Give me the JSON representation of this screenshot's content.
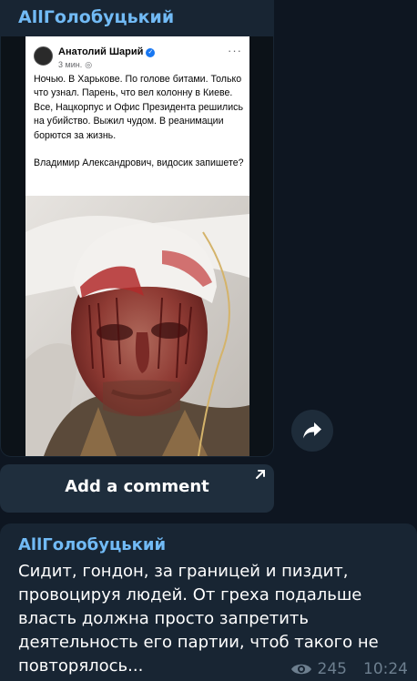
{
  "post": {
    "channel_name": "AllГолобуцький",
    "screenshot": {
      "author": "Анатолий Шарий",
      "time": "3 мин.",
      "more": "···",
      "text": "Ночью. В Харькове. По голове битами. Только что узнал. Парень, что вел колонну в Киеве. Все, Нацкорпус и Офис Президента решились на убийство. Выжил чудом. В реанимации борются за жизнь.\n\nВладимир Александрович, видосик запишете?"
    }
  },
  "comment_button": {
    "label": "Add a comment"
  },
  "reply": {
    "channel_name": "AllГолобуцький",
    "text": "Сидит, гондон, за границей и пиздит, провоцируя людей. От греха подальше власть должна просто запретить деятельность его партии, чтоб такого не повторялось...",
    "views": "245",
    "time": "10:24"
  },
  "icons": {
    "share": "share-arrow-icon",
    "open_comments": "arrow-up-right-icon",
    "views": "eye-icon",
    "verified": "verified-badge-icon",
    "audience": "globe-icon"
  },
  "colors": {
    "background": "#0e1621",
    "bubble": "#182533",
    "channel_name": "#71baf5",
    "meta": "#6d7f8f"
  }
}
